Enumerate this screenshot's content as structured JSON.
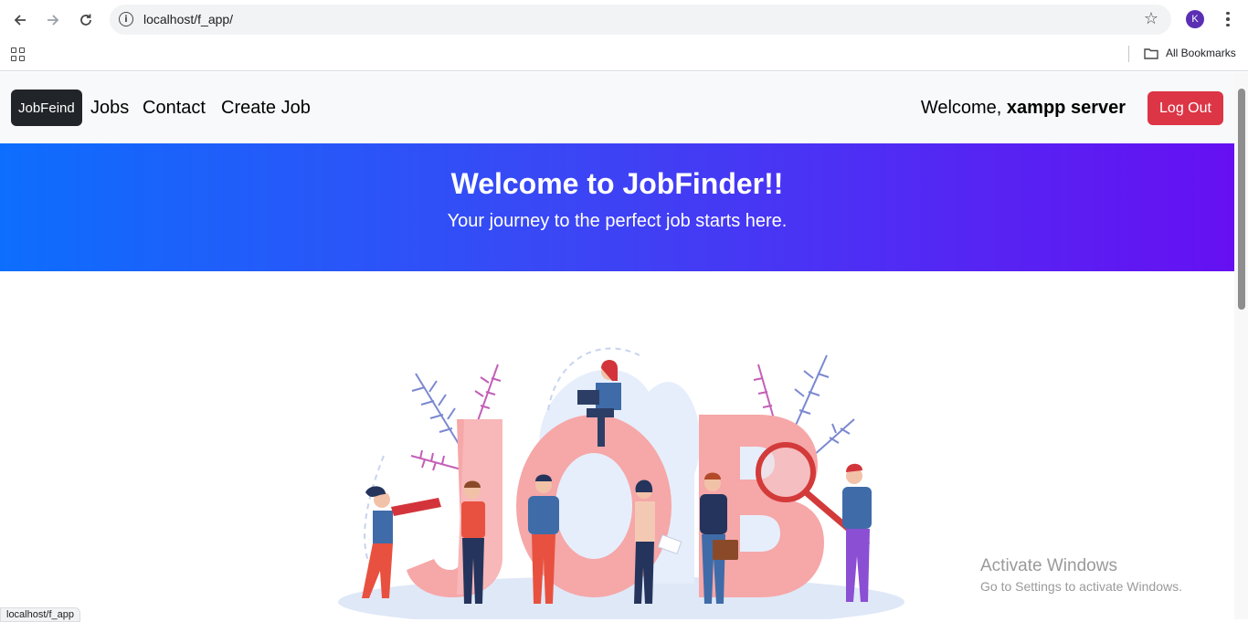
{
  "browser": {
    "url": "localhost/f_app/",
    "avatar_letter": "K",
    "bookmarks_label": "All Bookmarks",
    "status_url": "localhost/f_app"
  },
  "nav": {
    "brand": "JobFeind",
    "links": [
      "Jobs",
      "Contact",
      "Create Job"
    ],
    "welcome_prefix": "Welcome,",
    "username": "xampp server",
    "logout_label": "Log Out",
    "logout_color": "#dc3545"
  },
  "hero": {
    "title": "Welcome to JobFinder!!",
    "subtitle": "Your journey to the perfect job starts here.",
    "gradient_start": "#0d6efd",
    "gradient_end": "#6610f2"
  },
  "illustration": {
    "word": "JOB"
  },
  "os_overlay": {
    "title": "Activate Windows",
    "subtitle": "Go to Settings to activate Windows."
  }
}
